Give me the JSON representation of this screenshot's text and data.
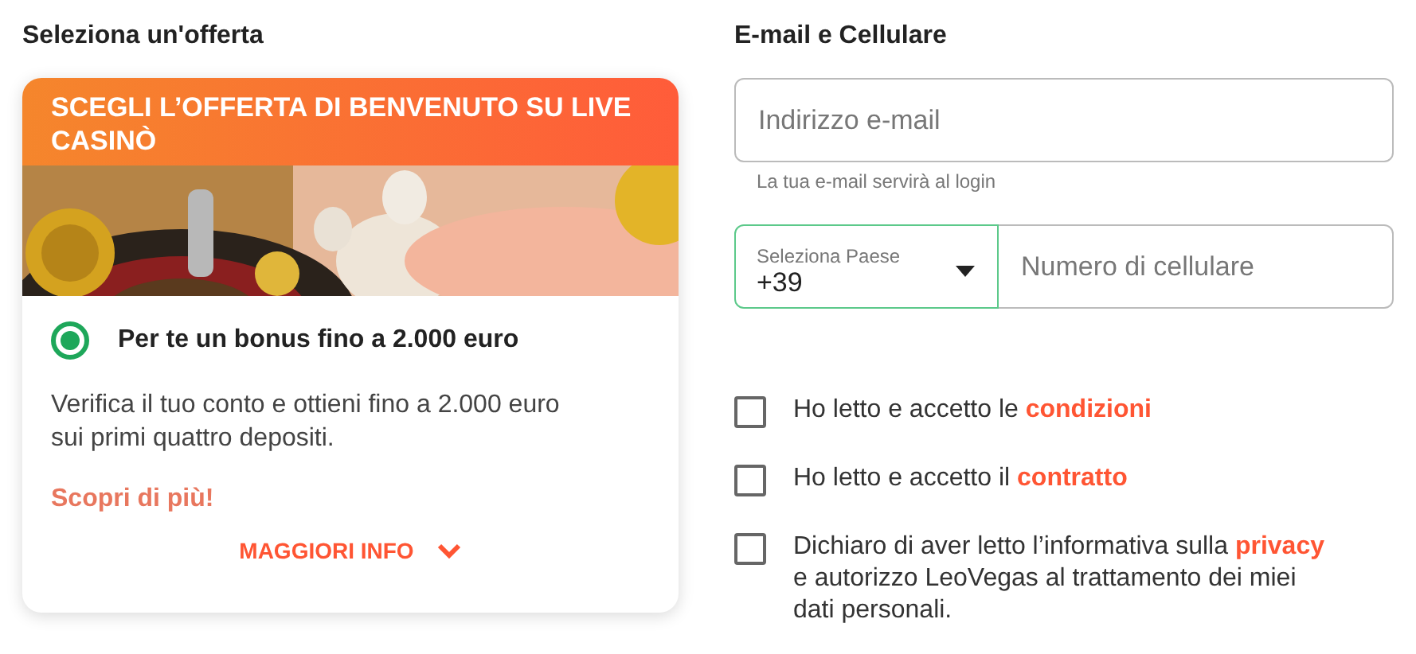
{
  "offer_section": {
    "title": "Seleziona un'offerta",
    "card": {
      "banner": "SCEGLI L’OFFERTA DI BENVENUTO SU LIVE CASINÒ",
      "option": {
        "label": "Per te un bonus fino a 2.000 euro",
        "selected": true
      },
      "description": "Verifica il tuo conto e ottieni fino a 2.000 euro sui primi quattro depositi.",
      "more_link": "Scopri di più!",
      "more_info": "MAGGIORI INFO"
    }
  },
  "contact_section": {
    "title": "E-mail e Cellulare",
    "email": {
      "placeholder": "Indirizzo e-mail",
      "hint": "La tua e-mail servirà al login"
    },
    "country": {
      "label": "Seleziona Paese",
      "value": "+39",
      "focused": true
    },
    "phone": {
      "placeholder": "Numero di cellulare"
    },
    "consents": [
      {
        "text": "Ho letto e accetto le ",
        "link": "condizioni",
        "checked": false
      },
      {
        "text": "Ho letto e accetto il ",
        "link": "contratto",
        "checked": false
      },
      {
        "text": "Dichiaro di aver letto l’informativa sulla ",
        "link": "privacy",
        "after": " e autorizzo LeoVegas al trattamento dei miei dati personali.",
        "checked": false
      }
    ]
  }
}
